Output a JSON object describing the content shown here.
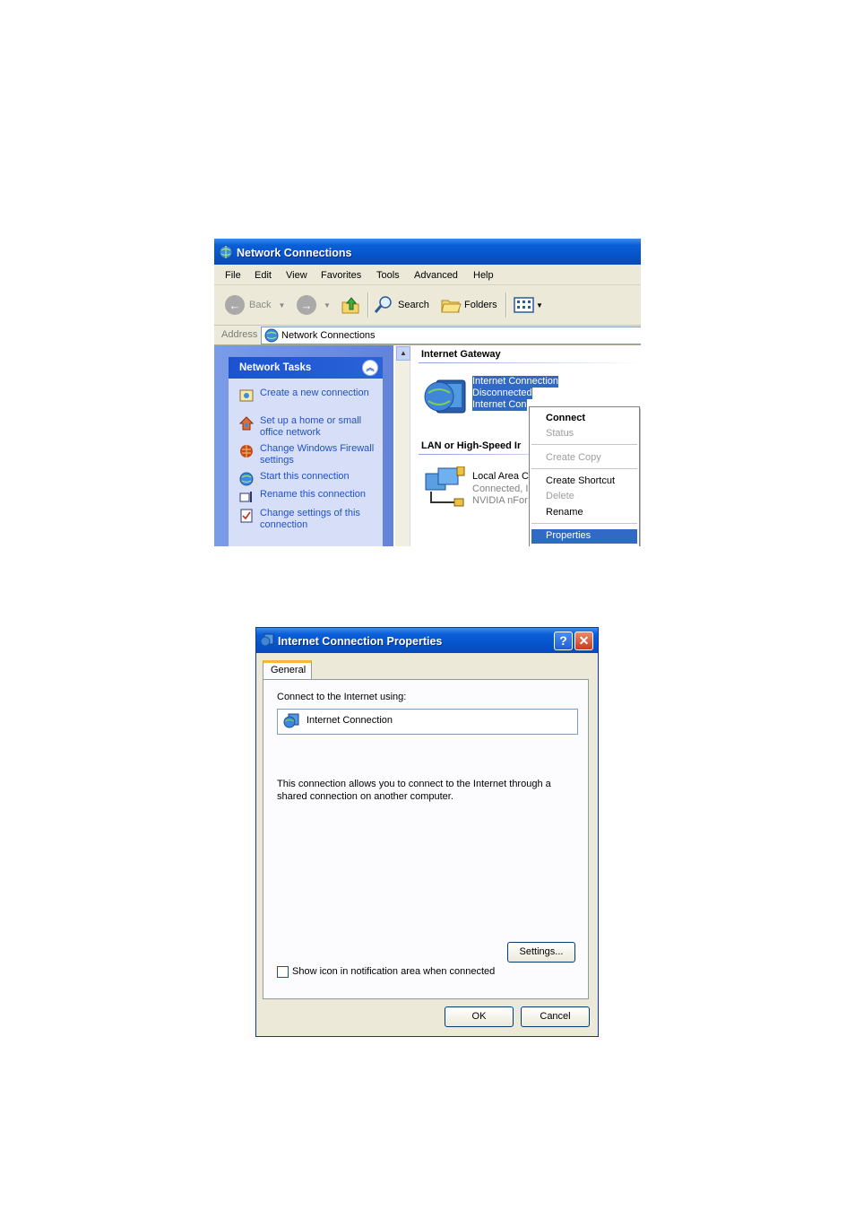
{
  "network_window": {
    "title": "Network Connections",
    "menu": [
      "File",
      "Edit",
      "View",
      "Favorites",
      "Tools",
      "Advanced",
      "Help"
    ],
    "toolbar": {
      "back": "Back",
      "search": "Search",
      "folders": "Folders"
    },
    "address": {
      "label": "Address",
      "value": "Network Connections"
    },
    "tasks": {
      "header": "Network Tasks",
      "items": [
        {
          "label": "Create a new connection",
          "icon": "new-connection-icon"
        },
        {
          "label": "Set up a home or small office network",
          "icon": "home-network-icon"
        },
        {
          "label": "Change Windows Firewall settings",
          "icon": "firewall-icon"
        },
        {
          "label": "Start this connection",
          "icon": "globe-icon"
        },
        {
          "label": "Rename this connection",
          "icon": "rename-icon"
        },
        {
          "label": "Change settings of this connection",
          "icon": "settings-icon"
        }
      ]
    },
    "groups": {
      "gateway": "Internet Gateway",
      "lan": "LAN or High-Speed Ir"
    },
    "gateway_item": {
      "line1": "Internet Connection",
      "line2": "Disconnected",
      "line3": "Internet Con"
    },
    "lan_item": {
      "line1": "Local Area C",
      "line2": "Connected, I",
      "line3": "NVIDIA nFor"
    },
    "context_menu": {
      "connect": "Connect",
      "status": "Status",
      "create_copy": "Create Copy",
      "create_shortcut": "Create Shortcut",
      "delete": "Delete",
      "rename": "Rename",
      "properties": "Properties"
    }
  },
  "properties_dialog": {
    "title": "Internet Connection Properties",
    "help_btn": "?",
    "close_btn": "✕",
    "tab": "General",
    "connect_using_label": "Connect to the Internet using:",
    "connection_name": "Internet Connection",
    "description_line1": "This connection allows you to connect to the Internet through a",
    "description_line2": "shared connection on another computer.",
    "settings_button": "Settings...",
    "show_icon_label": "Show icon in notification area when connected",
    "ok_button": "OK",
    "cancel_button": "Cancel"
  }
}
